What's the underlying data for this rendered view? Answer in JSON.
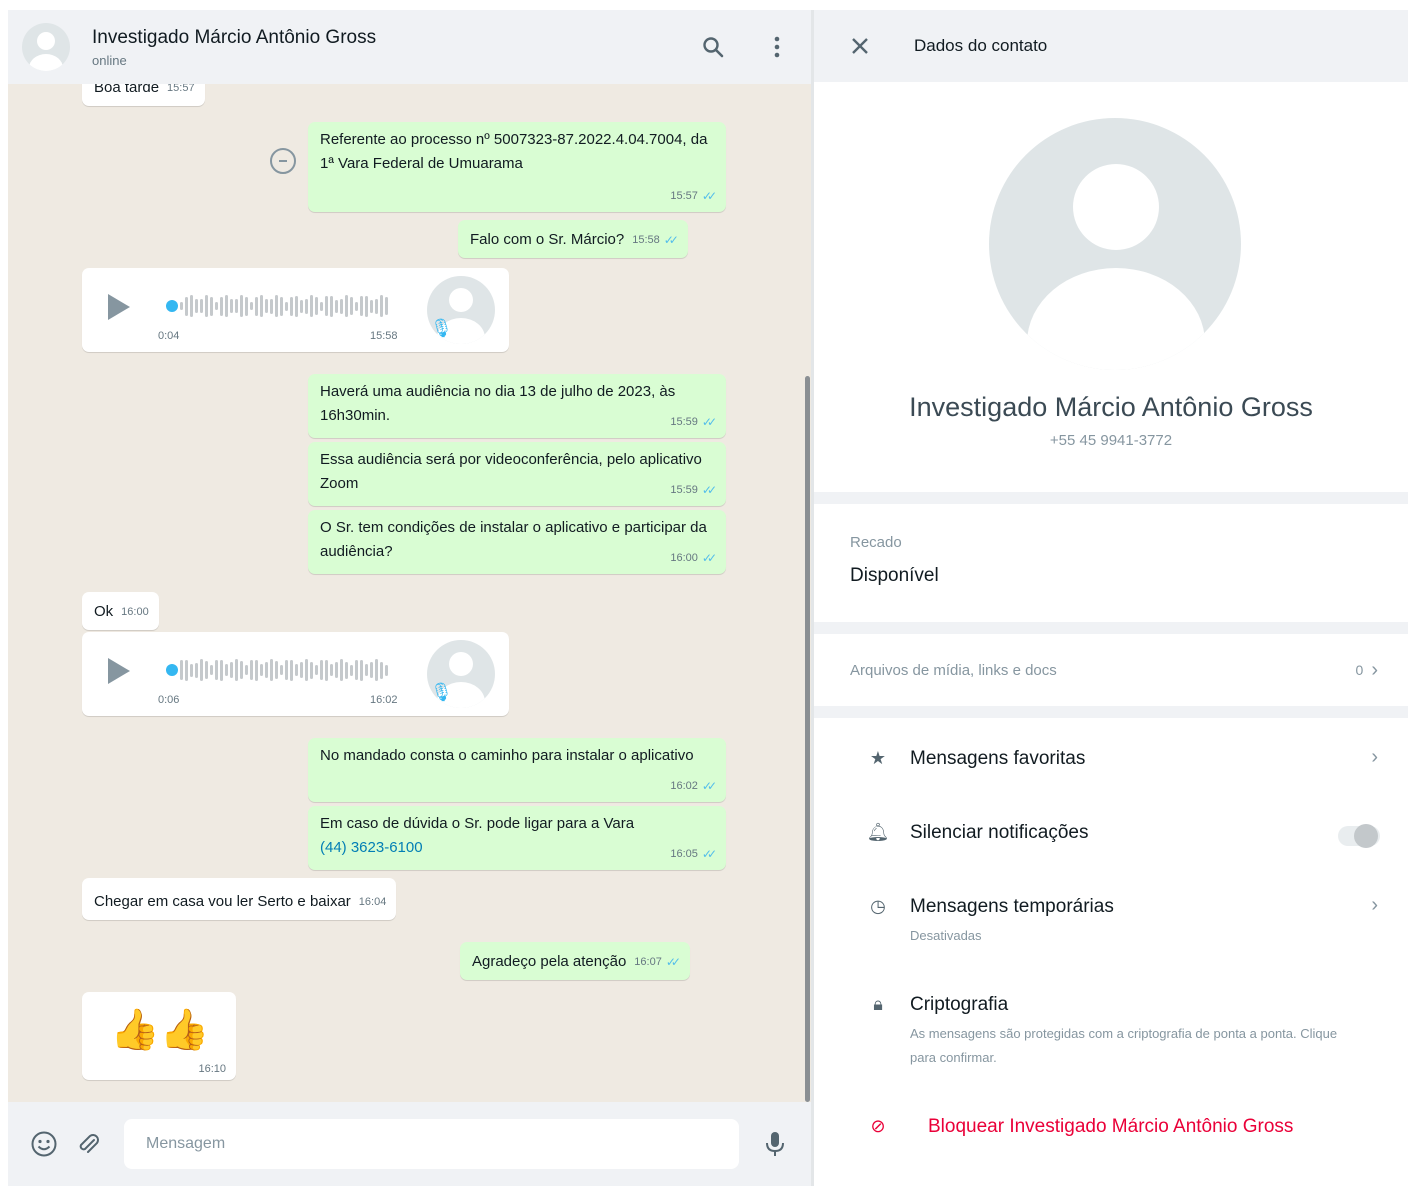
{
  "chat": {
    "contact_name": "Investigado Márcio Antônio Gross",
    "contact_status": "online",
    "header_icons": [
      "search-icon",
      "menu-icon"
    ],
    "messages": [
      {
        "type": "text",
        "dir": "in",
        "text": "Boa tarde",
        "time": "15:57"
      },
      {
        "type": "text",
        "dir": "out",
        "text": "Referente ao processo nº 5007323-87.2022.4.04.7004, da 1ª Vara Federal de Umuarama",
        "time": "15:57"
      },
      {
        "type": "text",
        "dir": "out",
        "text": "Falo com  o Sr. Márcio?",
        "time": "15:58"
      },
      {
        "type": "audio",
        "dir": "in",
        "duration": "0:04",
        "time": "15:58"
      },
      {
        "type": "text",
        "dir": "out",
        "text": "Haverá uma audiência no dia 13 de julho de 2023, às 16h30min.",
        "time": "15:59"
      },
      {
        "type": "text",
        "dir": "out",
        "text": "Essa audiência será por videoconferência, pelo aplicativo Zoom",
        "time": "15:59"
      },
      {
        "type": "text",
        "dir": "out",
        "text": "O Sr. tem condições de instalar o aplicativo e participar da audiência?",
        "time": "16:00"
      },
      {
        "type": "text",
        "dir": "in",
        "text": "Ok",
        "time": "16:00"
      },
      {
        "type": "audio",
        "dir": "in",
        "duration": "0:06",
        "time": "16:02"
      },
      {
        "type": "text",
        "dir": "out",
        "text": "No mandado consta o caminho para instalar o aplicativo",
        "time": "16:02"
      },
      {
        "type": "text",
        "dir": "out",
        "text": "Em caso de dúvida o Sr. pode ligar para a Vara",
        "link": "(44) 3623-6100",
        "time": "16:05"
      },
      {
        "type": "text",
        "dir": "in",
        "text": "Chegar em casa vou ler Serto e baixar",
        "time": "16:04"
      },
      {
        "type": "text",
        "dir": "out",
        "text": "Agradeço pela atenção",
        "time": "16:07"
      },
      {
        "type": "emoji",
        "dir": "in",
        "text": "👍👍",
        "time": "16:10"
      }
    ],
    "composer": {
      "placeholder": "Mensagem",
      "icons": [
        "emoji-icon",
        "attach-icon",
        "mic-icon"
      ]
    }
  },
  "panel": {
    "title": "Dados do contato",
    "name": "Investigado Márcio Antônio Gross",
    "phone": "+55 45 9941-3772",
    "about_label": "Recado",
    "about_value": "Disponível",
    "media_label": "Arquivos de mídia, links e docs",
    "media_count": "0",
    "options": [
      {
        "icon": "star-icon",
        "label": "Mensagens favoritas"
      },
      {
        "icon": "bell-icon",
        "label": "Silenciar notificações",
        "toggle": false
      },
      {
        "icon": "timer-icon",
        "label": "Mensagens temporárias",
        "sub": "Desativadas"
      },
      {
        "icon": "lock-icon",
        "label": "Criptografia",
        "sub": "As mensagens são protegidas com a criptografia de ponta a ponta. Clique para confirmar."
      },
      {
        "icon": "block-icon",
        "label": "Bloquear Investigado Márcio Antônio Gross"
      }
    ]
  },
  "colors": {
    "outgoing": "#d9fdd3",
    "incoming": "#ffffff",
    "background": "#efeae2",
    "danger": "#ea0038",
    "link": "#027eb5"
  }
}
